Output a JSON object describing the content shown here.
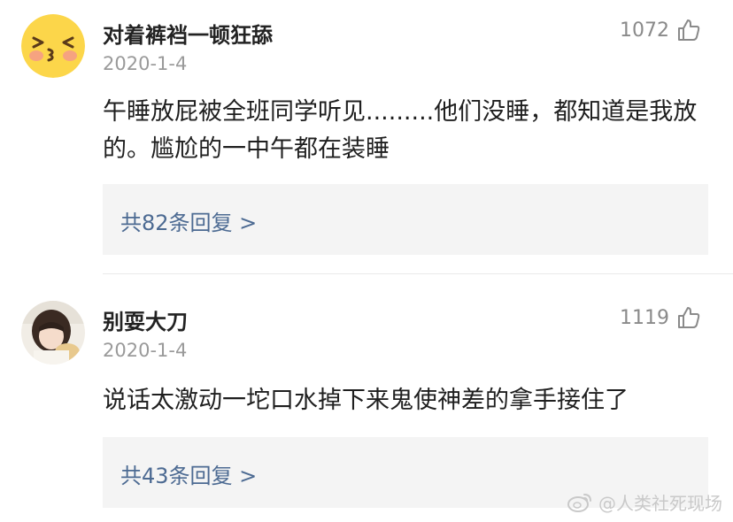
{
  "comments": [
    {
      "username": "对着裤裆一顿狂舔",
      "date": "2020-1-4",
      "likes": "1072",
      "text": "午睡放屁被全班同学听见.........他们没睡，都知道是我放的。尴尬的一中午都在装睡",
      "replies": "共82条回复 >",
      "avatar_icon": "smiling-emoji-avatar"
    },
    {
      "username": "别耍大刀",
      "date": "2020-1-4",
      "likes": "1119",
      "text": "说话太激动一坨口水掉下来鬼使神差的拿手接住了",
      "replies": "共43条回复 >",
      "avatar_icon": "girl-photo-avatar"
    }
  ],
  "watermark": {
    "text": "@人类社死现场",
    "icon": "weibo-logo-icon"
  },
  "colors": {
    "reply_link": "#4c6a92",
    "reply_bg": "#f4f4f4",
    "meta_gray": "#9a9a9a"
  }
}
